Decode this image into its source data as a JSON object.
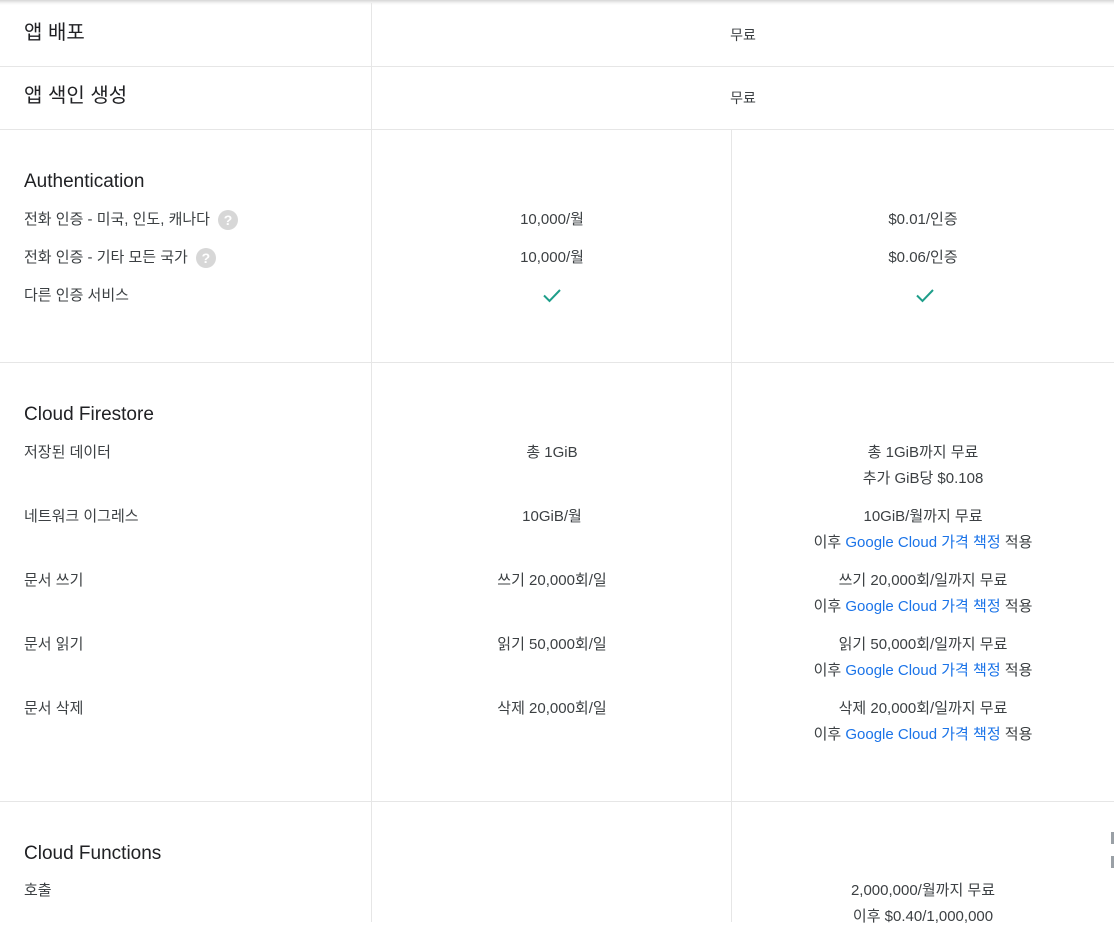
{
  "rows": {
    "app_deploy": {
      "label": "앱 배포",
      "value": "무료"
    },
    "app_indexing": {
      "label": "앱 색인 생성",
      "value": "무료"
    }
  },
  "auth": {
    "heading": "Authentication",
    "phone_us": {
      "label": "전화 인증 - 미국, 인도, 캐나다",
      "free": "10,000/월",
      "paid": "$0.01/인증"
    },
    "phone_other": {
      "label": "전화 인증 - 기타 모든 국가",
      "free": "10,000/월",
      "paid": "$0.06/인증"
    },
    "other": {
      "label": "다른 인증 서비스",
      "free_icon": "check-icon",
      "paid_icon": "check-icon"
    },
    "help_glyph": "?"
  },
  "firestore": {
    "heading": "Cloud Firestore",
    "stored": {
      "label": "저장된 데이터",
      "free": "총 1GiB",
      "paid_1": "총 1GiB까지 무료",
      "paid_2": "추가 GiB당 $0.108"
    },
    "egress": {
      "label": "네트워크 이그레스",
      "free": "10GiB/월",
      "paid_1": "10GiB/월까지 무료"
    },
    "writes": {
      "label": "문서 쓰기",
      "free": "쓰기 20,000회/일",
      "paid_1": "쓰기 20,000회/일까지 무료"
    },
    "reads": {
      "label": "문서 읽기",
      "free": "읽기 50,000회/일",
      "paid_1": "읽기 50,000회/일까지 무료"
    },
    "deletes": {
      "label": "문서 삭제",
      "free": "삭제 20,000회/일",
      "paid_1": "삭제 20,000회/일까지 무료"
    },
    "after_prefix": "이후 ",
    "pricing_link": "Google Cloud 가격 책정",
    "after_suffix": " 적용"
  },
  "functions": {
    "heading": "Cloud Functions",
    "invocations": {
      "label": "호출",
      "paid_1": "2,000,000/월까지 무료",
      "paid_2": "이후 $0.40/1,000,000"
    }
  },
  "colors": {
    "link": "#1a73e8",
    "check": "#1e9e8a",
    "divider": "#e6e6e6"
  }
}
